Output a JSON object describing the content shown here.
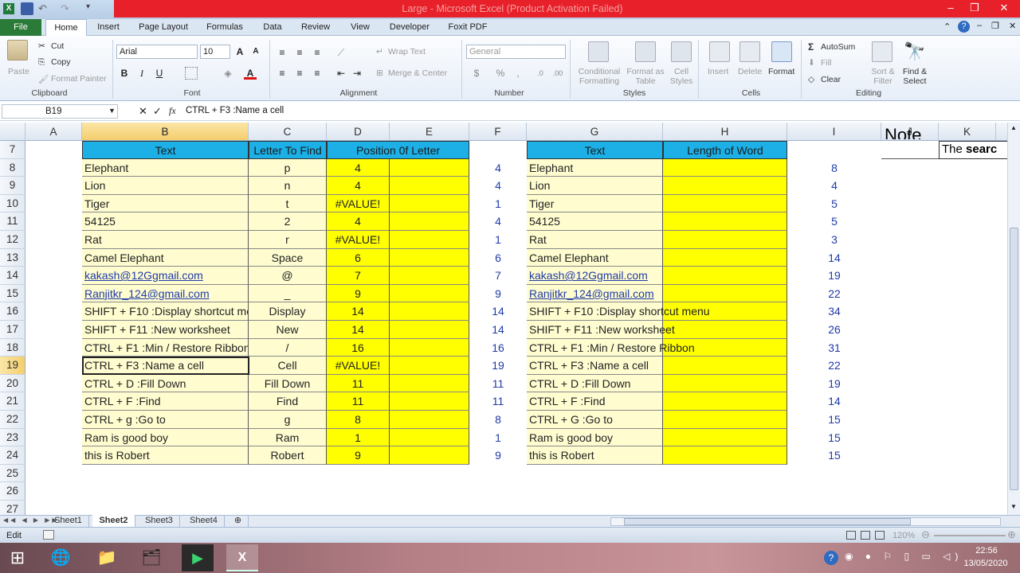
{
  "window": {
    "title": "Large  -  Microsoft Excel (Product Activation Failed)"
  },
  "ribbon_tabs": [
    "File",
    "Home",
    "Insert",
    "Page Layout",
    "Formulas",
    "Data",
    "Review",
    "View",
    "Developer",
    "Foxit PDF"
  ],
  "clipboard": {
    "paste": "Paste",
    "cut": "Cut",
    "copy": "Copy",
    "format_painter": "Format Painter",
    "group": "Clipboard"
  },
  "font": {
    "name": "Arial",
    "size": "10",
    "group": "Font",
    "bold": "B",
    "italic": "I",
    "underline": "U"
  },
  "alignment": {
    "wrap": "Wrap Text",
    "merge": "Merge & Center",
    "group": "Alignment"
  },
  "number": {
    "format": "General",
    "group": "Number",
    "percent": "%",
    "comma": ","
  },
  "styles": {
    "conditional": "Conditional Formatting",
    "format_table": "Format as Table",
    "cell_styles": "Cell Styles",
    "group": "Styles"
  },
  "cells": {
    "insert": "Insert",
    "delete": "Delete",
    "format": "Format",
    "group": "Cells"
  },
  "editing": {
    "autosum": "AutoSum",
    "fill": "Fill",
    "clear": "Clear",
    "sort": "Sort & Filter",
    "find": "Find & Select",
    "group": "Editing"
  },
  "formula_bar": {
    "name_box": "B19",
    "content": "CTRL + F3 :Name a cell",
    "fx": "fx",
    "cancel": "✕",
    "enter": "✓"
  },
  "columns": [
    "A",
    "B",
    "C",
    "D",
    "E",
    "F",
    "G",
    "H",
    "I",
    "J",
    "K"
  ],
  "rows": [
    "7",
    "8",
    "9",
    "10",
    "11",
    "12",
    "13",
    "14",
    "15",
    "16",
    "17",
    "18",
    "19",
    "20",
    "21",
    "22",
    "23",
    "24",
    "25",
    "26",
    "27"
  ],
  "table1": {
    "headers": [
      "Text",
      "Letter To Find",
      "Position 0f Letter"
    ],
    "rows": [
      [
        "Elephant",
        "p",
        "4"
      ],
      [
        "Lion",
        "n",
        "4"
      ],
      [
        "Tiger",
        "t",
        "#VALUE!"
      ],
      [
        "54125",
        "2",
        "4"
      ],
      [
        "Rat",
        "r",
        "#VALUE!"
      ],
      [
        "Camel Elephant",
        "Space",
        "6"
      ],
      [
        "kakash@12Ggmail.com",
        "@",
        "7"
      ],
      [
        "Ranjitkr_124@gmail.com",
        "_",
        "9"
      ],
      [
        "SHIFT + F10 :Display shortcut menu",
        "Display",
        "14"
      ],
      [
        "SHIFT + F11 :New worksheet",
        "New",
        "14"
      ],
      [
        "CTRL + F1 :Min / Restore Ribbon",
        "/",
        "16"
      ],
      [
        "CTRL + F3 :Name a cell",
        "Cell",
        "#VALUE!"
      ],
      [
        "CTRL + D :Fill Down",
        "Fill Down",
        "11"
      ],
      [
        "CTRL + F :Find",
        "Find",
        "11"
      ],
      [
        "CTRL + g :Go to",
        "g",
        "8"
      ],
      [
        "Ram is good boy",
        "Ram",
        "1"
      ],
      [
        "this is Robert",
        "Robert",
        "9"
      ]
    ]
  },
  "col_f": [
    "4",
    "4",
    "1",
    "4",
    "1",
    "6",
    "7",
    "9",
    "14",
    "14",
    "16",
    "19",
    "11",
    "11",
    "8",
    "1",
    "9"
  ],
  "table2": {
    "headers": [
      "Text",
      "Length of Word"
    ],
    "rows": [
      "Elephant",
      "Lion",
      "Tiger",
      "54125",
      "Rat",
      "Camel Elephant",
      "kakash@12Ggmail.com",
      "Ranjitkr_124@gmail.com",
      "SHIFT + F10 :Display shortcut menu",
      "SHIFT + F11 :New worksheet",
      "CTRL + F1 :Min / Restore Ribbon",
      "CTRL + F3 :Name a cell",
      "CTRL + D :Fill Down",
      "CTRL + F :Find",
      "CTRL + G :Go to",
      "Ram is good boy",
      "this is Robert"
    ]
  },
  "col_i": [
    "8",
    "4",
    "5",
    "5",
    "3",
    "14",
    "19",
    "22",
    "34",
    "26",
    "31",
    "22",
    "19",
    "14",
    "15",
    "15",
    "15"
  ],
  "overflow": {
    "j": "Note",
    "k1": "The ",
    "k2": "searc"
  },
  "sheets": [
    "Sheet1",
    "Sheet2",
    "Sheet3",
    "Sheet4"
  ],
  "active_sheet": "Sheet2",
  "status": {
    "mode": "Edit",
    "zoom": "120%"
  },
  "clock": {
    "time": "22:56",
    "date": "13/05/2020"
  },
  "colors": {
    "header_blue": "#1cb0e6",
    "yellow": "#ffff00",
    "light_yellow": "#fffdd0",
    "red_bar": "#e8202a",
    "file_green": "#2a7a38"
  }
}
